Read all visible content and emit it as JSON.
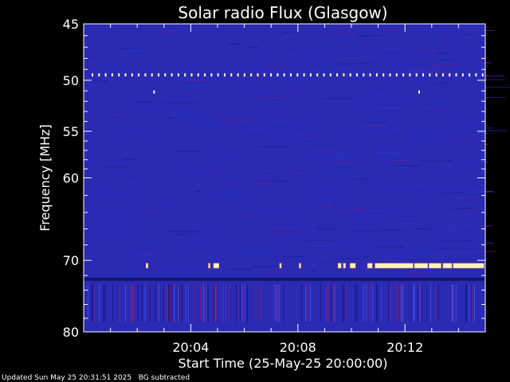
{
  "chart_data": {
    "type": "heatmap",
    "title": "Solar radio Flux (Glasgow)",
    "xlabel": "Start Time (25-May-25 20:00:00)",
    "ylabel": "Frequency [MHz]",
    "x_unit": "minutes after 20:00",
    "xlim": [
      0,
      15
    ],
    "ylim": [
      45,
      80
    ],
    "y_scale": "log",
    "x_ticks": [
      {
        "value": 4,
        "label": "20:04"
      },
      {
        "value": 8,
        "label": "20:08"
      },
      {
        "value": 12,
        "label": "20:12"
      }
    ],
    "y_ticks": [
      {
        "value": 45,
        "label": "45"
      },
      {
        "value": 50,
        "label": "50"
      },
      {
        "value": 55,
        "label": "55"
      },
      {
        "value": 60,
        "label": "60"
      },
      {
        "value": 70,
        "label": "70"
      },
      {
        "value": 80,
        "label": "80"
      }
    ],
    "interference_band_mhz": 49.5,
    "interference_band_2_mhz": 70.7,
    "background_color": "#2a2ab4",
    "hot_color": "#fff8c0"
  },
  "footer": {
    "updated": "Updated Sun May 25 20:31:51 2025",
    "note": "BG subtracted"
  }
}
